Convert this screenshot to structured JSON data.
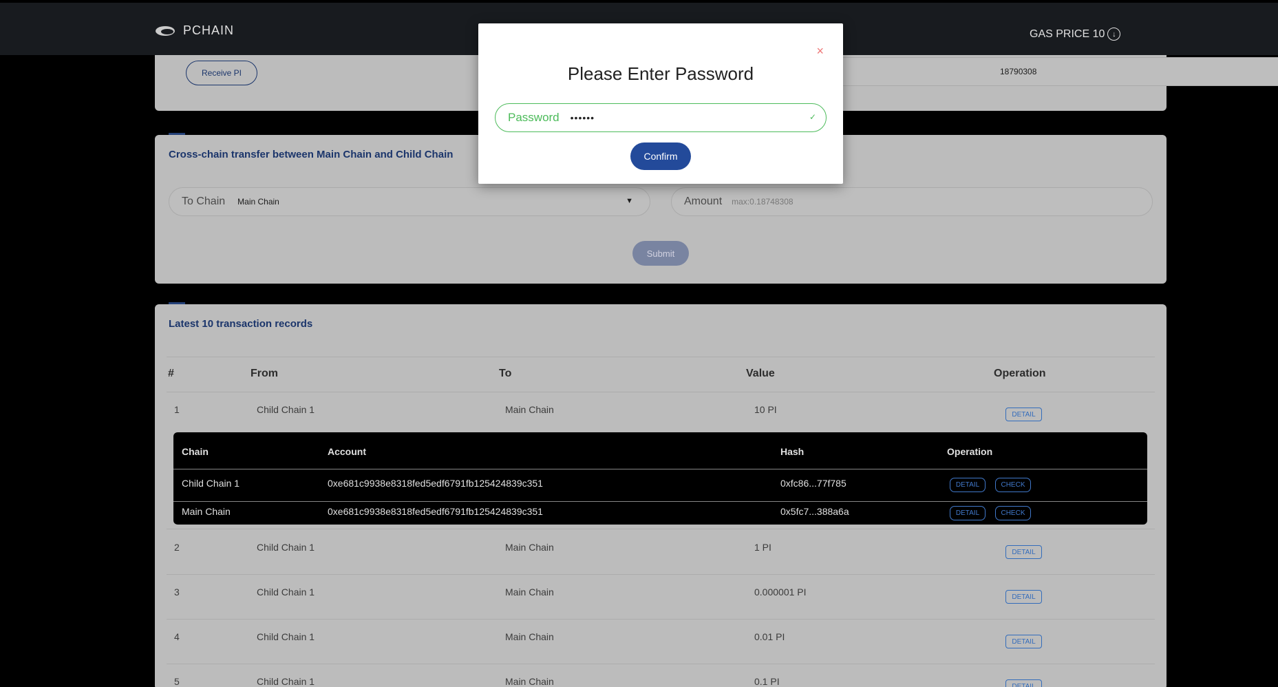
{
  "header": {
    "brand": "PCHAIN",
    "gas_label": "GAS PRICE 10"
  },
  "receive": {
    "button": "Receive PI",
    "address_fragment": "18790308"
  },
  "cross_chain": {
    "title": "Cross-chain transfer between Main Chain and Child Chain",
    "to_chain_label": "To Chain",
    "to_chain_value": "Main Chain",
    "amount_label": "Amount",
    "amount_placeholder": "max:0.18748308",
    "submit": "Submit"
  },
  "transactions": {
    "title": "Latest 10 transaction records",
    "headers": [
      "#",
      "From",
      "To",
      "Value",
      "Operation"
    ],
    "rows": [
      {
        "num": "1",
        "from": "Child Chain 1",
        "to": "Main Chain",
        "value": "10 PI",
        "op": "DETAIL"
      },
      {
        "num": "2",
        "from": "Child Chain 1",
        "to": "Main Chain",
        "value": "1 PI",
        "op": "DETAIL"
      },
      {
        "num": "3",
        "from": "Child Chain 1",
        "to": "Main Chain",
        "value": "0.000001 PI",
        "op": "DETAIL"
      },
      {
        "num": "4",
        "from": "Child Chain 1",
        "to": "Main Chain",
        "value": "0.01 PI",
        "op": "DETAIL"
      },
      {
        "num": "5",
        "from": "Child Chain 1",
        "to": "Main Chain",
        "value": "0.1 PI",
        "op": "DETAIL"
      }
    ],
    "detail": {
      "headers": [
        "Chain",
        "Account",
        "Hash",
        "Operation"
      ],
      "rows": [
        {
          "chain": "Child Chain 1",
          "account": "0xe681c9938e8318fed5edf6791fb125424839c351",
          "hash": "0xfc86...77f785",
          "detail": "DETAIL",
          "check": "CHECK"
        },
        {
          "chain": "Main Chain",
          "account": "0xe681c9938e8318fed5edf6791fb125424839c351",
          "hash": "0x5fc7...388a6a",
          "detail": "DETAIL",
          "check": "CHECK"
        }
      ]
    }
  },
  "modal": {
    "close": "×",
    "title": "Please Enter Password",
    "password_label": "Password",
    "password_value": "••••••",
    "confirm": "Confirm"
  },
  "colors": {
    "accent": "#234a9a",
    "success": "#4cbb5a",
    "link": "#3a7bd5"
  }
}
